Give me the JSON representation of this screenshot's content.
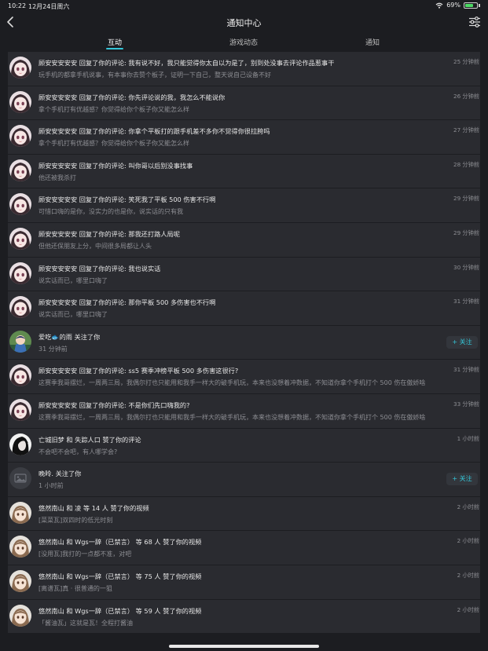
{
  "status": {
    "time": "10:22",
    "date": "12月24日周六",
    "battery": "69%",
    "battery_level": 0.69
  },
  "header": {
    "title": "通知中心",
    "back_icon": "chevron-left-icon",
    "settings_icon": "sliders-icon"
  },
  "tabs": [
    {
      "label": "互动",
      "active": true
    },
    {
      "label": "游戏动态",
      "active": false
    },
    {
      "label": "通知",
      "active": false
    }
  ],
  "notifications": [
    {
      "avatar": "anime-girl",
      "title": "顾安安安安安 回复了你的评论: 我有说不好，我只能觉得你太自以为是了，别到处没事去评论作品惹事干",
      "sub": "玩手机的都拿手机说事，有本事你去赞个板子，证明一下自己，整天说自己设备不好",
      "time": "25 分钟前"
    },
    {
      "avatar": "anime-girl",
      "title": "顾安安安安安 回复了你的评论: 你先评论说的我，我怎么不能说你",
      "sub": "拿个手机打有优越感？你觉得给你个板子你又能怎么样",
      "time": "26 分钟前"
    },
    {
      "avatar": "anime-girl",
      "title": "顾安安安安安 回复了你的评论: 你拿个平板打的跟手机差不多你不觉得你很拉胯吗",
      "sub": "拿个手机打有优越感？你觉得给你个板子你又能怎么样",
      "time": "27 分钟前"
    },
    {
      "avatar": "anime-girl",
      "title": "顾安安安安安 回复了你的评论: 叫你哥以后别没事找事",
      "sub": "他还被我杀打",
      "time": "28 分钟前"
    },
    {
      "avatar": "anime-girl",
      "title": "顾安安安安安 回复了你的评论: 笑死我了平板 500 伤害不行啊",
      "sub": "可惜口嗨的是你，没实力的也是你，说实话的只有我",
      "time": "29 分钟前"
    },
    {
      "avatar": "anime-girl",
      "title": "顾安安安安安 回复了你的评论: 那我还打路人局呢",
      "sub": "但他还保朋友上分，中间很多局都让人头",
      "time": "29 分钟前"
    },
    {
      "avatar": "anime-girl",
      "title": "顾安安安安安 回复了你的评论: 我也说实话",
      "sub": "说实话而已，哪里口嗨了",
      "time": "30 分钟前"
    },
    {
      "avatar": "anime-girl",
      "title": "顾安安安安安 回复了你的评论: 那你平板 500 多伤害也不行啊",
      "sub": "说实话而已，哪里口嗨了",
      "time": "31 分钟前"
    },
    {
      "avatar": "anime-boy",
      "title": "爱吃🐟的雨 关注了你",
      "sub": "31 分钟前",
      "follow": "+ 关注"
    },
    {
      "avatar": "anime-girl",
      "title": "顾安安安安安 回复了你的评论: ss5 赛季冲榜平板 500 多伤害这很行?",
      "sub": "这赛季我哥摆烂，一周两三局，我偶尔打也只能用和我手一样大的破手机玩，本来也没想着冲数据，不知道你拿个手机打个 500 伤在傲娇啥",
      "time": "31 分钟前"
    },
    {
      "avatar": "anime-girl",
      "title": "顾安安安安安 回复了你的评论: 不是你们先口嗨我的?",
      "sub": "这赛季我哥摆烂，一周两三局，我偶尔打也只能用和我手一样大的破手机玩，本来也没想着冲数据，不知道你拿个手机打个 500 伤在傲娇啥",
      "time": "33 分钟前"
    },
    {
      "avatar": "dark-character",
      "title": "亡城旧梦 和 失踪人口 赞了你的评论",
      "sub": "不会吧不会吧，有人哪学会?",
      "time": "1 小时前"
    },
    {
      "avatar": "placeholder",
      "title": "晚昤. 关注了你",
      "sub": "1 小时前",
      "follow": "+ 关注"
    },
    {
      "avatar": "anime-boy-2",
      "title": "悠然南山 和 凌 等 14 人 赞了你的视频",
      "sub": "[菜菜瓦]双四时的低光时刻",
      "time": "2 小时前"
    },
    {
      "avatar": "anime-boy-2",
      "title": "悠然南山 和 Wgs一辞（已禁言） 等 68 人 赞了你的视频",
      "sub": "[没用瓦]我打的一点都不准，对吧",
      "time": "2 小时前"
    },
    {
      "avatar": "anime-boy-2",
      "title": "悠然南山 和 Wgs一辞（已禁言） 等 75 人 赞了你的视频",
      "sub": "[离谱瓦]真 · 很普通的一狙",
      "time": "2 小时前"
    },
    {
      "avatar": "anime-boy-2",
      "title": "悠然南山 和 Wgs一辞（已禁言） 等 59 人 赞了你的视频",
      "sub": "「酱油瓦」这就是瓦！全程打酱油",
      "time": "2 小时前"
    }
  ]
}
